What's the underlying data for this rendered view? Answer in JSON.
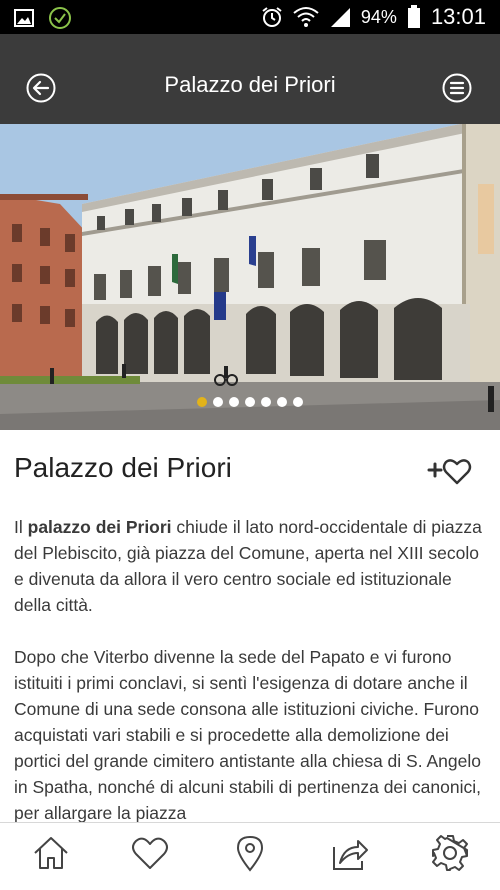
{
  "statusbar": {
    "battery": "94%",
    "time": "13:01",
    "icons": [
      "image-icon",
      "check-circle-icon",
      "alarm-icon",
      "wifi-icon",
      "signal-icon",
      "battery-icon"
    ]
  },
  "appbar": {
    "title": "Palazzo dei Priori",
    "back_icon": "back-arrow-icon",
    "menu_icon": "menu-icon"
  },
  "gallery": {
    "image": "palazzo-photo",
    "dots_total": 7,
    "active_index": 0
  },
  "content": {
    "title": "Palazzo dei Priori",
    "p1": {
      "pre": "Il ",
      "bold": "palazzo dei Priori",
      "post": " chiude il lato nord-occidentale di piazza del Plebiscito, già piazza del Comune, aperta nel XIII secolo e divenuta da allora il vero centro sociale ed istituzionale della città."
    },
    "p2": "Dopo che Viterbo divenne la sede del Papato e vi furono istituiti i primi conclavi, si sentì l'esigenza di dotare anche il Comune di una sede consona alle istituzioni civiche. Furono acquistati vari stabili e si procedette alla demolizione dei portici del grande cimitero antistante alla chiesa di S. Angelo in Spatha, nonché di alcuni stabili di pertinenza dei canonici, per allargare la piazza"
  },
  "bottom_nav": [
    "home-icon",
    "heart-icon",
    "location-pin-icon",
    "share-icon",
    "settings-gear-icon"
  ],
  "colors": {
    "appbar": "#3b3b3b",
    "statusbar": "#000000",
    "accent_dot": "#e2b31a",
    "sky": "#a9c6e3"
  }
}
